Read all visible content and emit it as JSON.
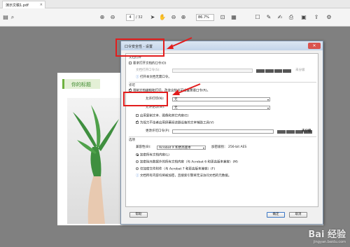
{
  "tab": {
    "title": "演示文稿1.pdf",
    "close": "×"
  },
  "toolbar": {
    "page_current": "4",
    "page_total": "/ 32",
    "zoom": "86.7%"
  },
  "document": {
    "title": "你的标题"
  },
  "dialog": {
    "title": "口令安全性 - 设置",
    "close": "✕",
    "open_section": "文档打开",
    "require_open_pwd": "要求打开文档的口令(O)",
    "open_pwd_label": "文档打开口令(S):",
    "not_rated": "未分级",
    "open_hint": "打开本文档无需口令。",
    "permissions_section": "许可",
    "restrict_edit": "限制文档编辑和打印。改变这些许可设置需要口令(R)。",
    "print_allowed_label": "允许打印(N):",
    "print_allowed_value": "无",
    "changes_allowed_label": "允许更改(W):",
    "changes_allowed_value": "无",
    "enable_copy": "启用复制文本、图像和其它内容(E)",
    "enable_access": "为视力不佳者启用屏幕阅读器设备的文本辅助工具(V)",
    "perm_pwd_label": "更改许可口令(P):",
    "perm_rating": "未分级",
    "options_section": "选项",
    "compat_label": "兼容性(B):",
    "compat_value": "Acrobat X 和更高版本",
    "encrypt_level": "加密级别：",
    "encrypt_value": "256-bit AES",
    "encrypt_all": "加密所有文档内容(L)",
    "encrypt_except_meta": "加密除元数据外的所有文档内容（与 Acrobat 6 和更高版本兼容）(M)",
    "encrypt_attach": "仅加密文件附件（与 Acrobat 7 和更高版本兼容）(F)",
    "meta_hint": "文档所有内容均将被加密，且搜索引擎将无法访问文档的元数据。",
    "help_btn": "帮助",
    "ok_btn": "确定",
    "cancel_btn": "取消"
  },
  "watermark": {
    "main": "Bai 经验",
    "sub": "jingyan.baidu.com"
  },
  "colors": {
    "annotation": "#e21d1d",
    "accent_green": "#3d8a2e"
  }
}
